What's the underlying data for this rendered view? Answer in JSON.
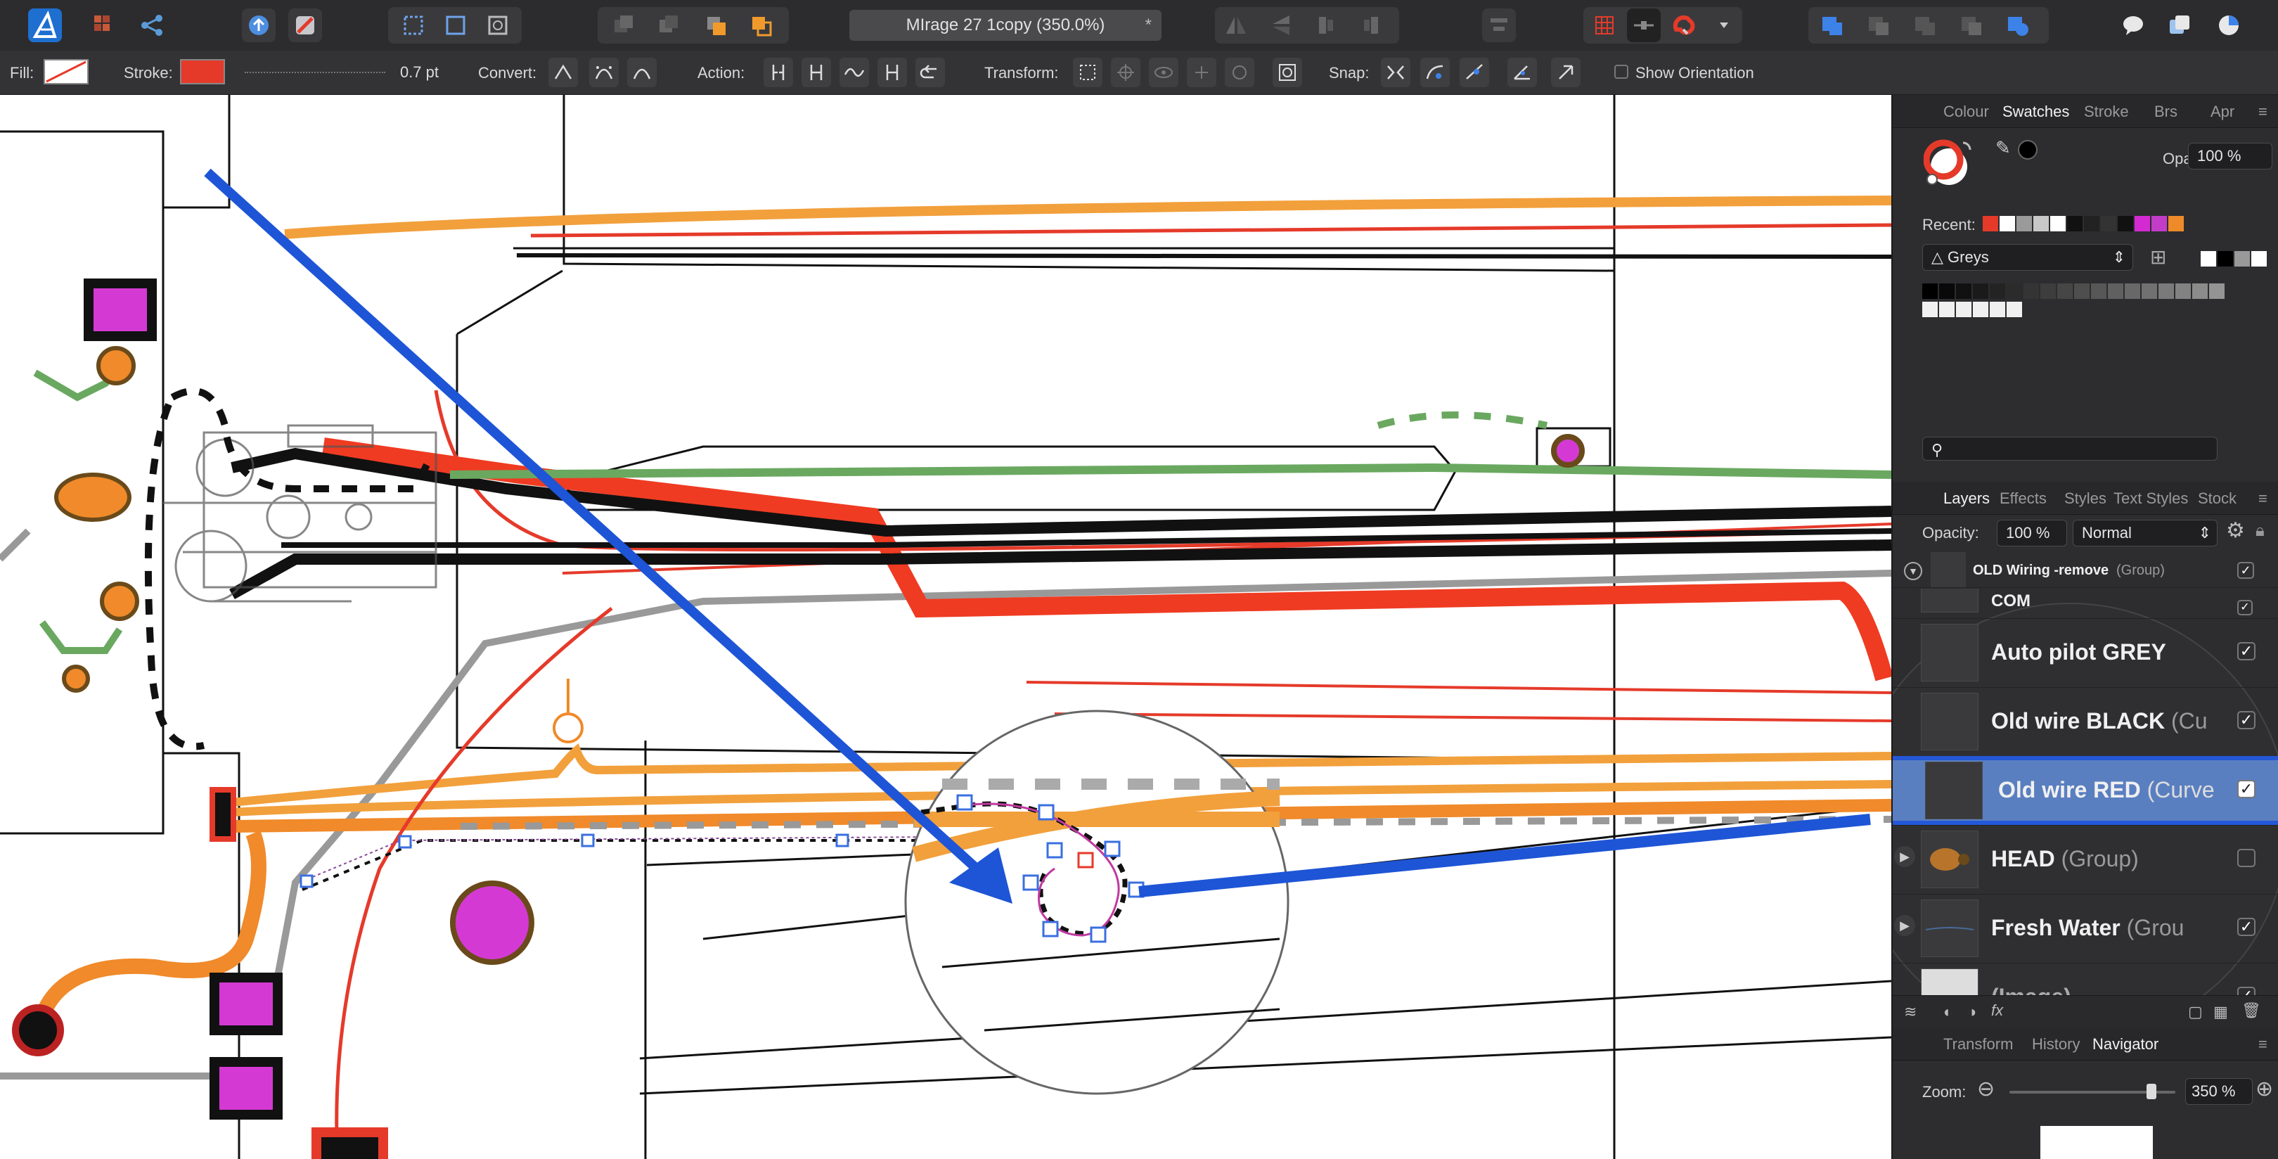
{
  "toolbar": {
    "document_title": "MIrage 27 1copy (350.0%)",
    "modified_marker": "*"
  },
  "context_bar": {
    "fill_label": "Fill:",
    "stroke_label": "Stroke:",
    "stroke_width_value": "0.7 pt",
    "convert_label": "Convert:",
    "action_label": "Action:",
    "transform_label": "Transform:",
    "snap_label": "Snap:",
    "show_orientation_label": "Show Orientation",
    "stroke_color": "#e53a2a"
  },
  "swatches_panel": {
    "tabs": [
      "Colour",
      "Swatches",
      "Stroke",
      "Brs",
      "Apr"
    ],
    "active_tab": "Swatches",
    "opacity_label": "Opacity:",
    "opacity_value": "100 %",
    "recent_label": "Recent:",
    "recent_colors": [
      "#e53a2a",
      "#ffffff",
      "#9a9a9a",
      "#c8c8c8",
      "#ffffff",
      "#111111",
      "#222222",
      "#333333",
      "#111111",
      "#d42ad2",
      "#c23cc8",
      "#ef8a2a"
    ],
    "palette_name": "Greys",
    "search_icon": "search-icon"
  },
  "layers_panel": {
    "tabs": [
      "Layers",
      "Effects",
      "Styles",
      "Text Styles",
      "Stock"
    ],
    "active_tab": "Layers",
    "opacity_label": "Opacity:",
    "opacity_value": "100 %",
    "blend_mode": "Normal",
    "group_row": {
      "name": "OLD Wiring -remove",
      "kind": "(Group)"
    },
    "rows": [
      {
        "name": "COM",
        "kind": ""
      },
      {
        "name": "Auto pilot GREY",
        "kind": ""
      },
      {
        "name": "Old wire BLACK",
        "kind": "(Cu"
      },
      {
        "name": "Old wire RED",
        "kind": "(Curve"
      },
      {
        "name": "HEAD",
        "kind": "(Group)"
      },
      {
        "name": "Fresh Water",
        "kind": "(Grou"
      },
      {
        "name": "(Image)",
        "kind": ""
      }
    ]
  },
  "navigator_panel": {
    "tabs": [
      "Transform",
      "History",
      "Navigator"
    ],
    "active_tab": "Navigator",
    "zoom_label": "Zoom:",
    "zoom_value": "350 %",
    "zoom_fraction": 0.88
  },
  "colors": {
    "accent_blue": "#1e55d6",
    "selected_row": "#5a7fc0",
    "wire_red": "#e53a2a",
    "wire_orange": "#f0962c",
    "wire_green": "#6aa860",
    "pad_magenta": "#d43ad3"
  }
}
